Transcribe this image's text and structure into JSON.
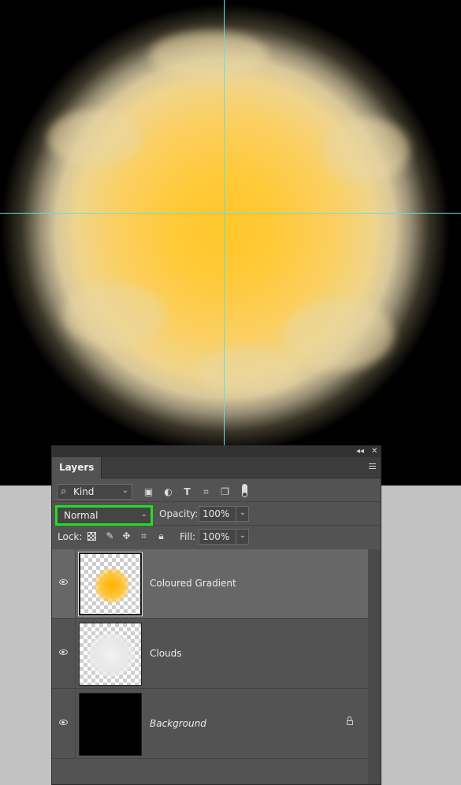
{
  "panel": {
    "collapse_label": "◂◂",
    "close_label": "✕",
    "tab_label": "Layers"
  },
  "filter": {
    "kind_label": "Kind",
    "icons": [
      "image-filter-icon",
      "adjustment-filter-icon",
      "type-filter-icon",
      "shape-filter-icon",
      "smart-object-filter-icon",
      "filter-toggle"
    ]
  },
  "blend": {
    "mode": "Normal",
    "opacity_label": "Opacity:",
    "opacity_value": "100%"
  },
  "lock": {
    "label": "Lock:",
    "fill_label": "Fill:",
    "fill_value": "100%",
    "icons": [
      "lock-transparent-icon",
      "lock-image-icon",
      "lock-position-icon",
      "lock-artboard-icon",
      "lock-all-icon"
    ]
  },
  "layers": [
    {
      "name": "Coloured Gradient",
      "selected": true,
      "visible": true
    },
    {
      "name": "Clouds",
      "selected": false,
      "visible": true
    },
    {
      "name": "Background",
      "selected": false,
      "visible": true,
      "locked": true
    }
  ],
  "colors": {
    "highlight": "#22dd22",
    "guide": "#5fe0e0",
    "panel_bg": "#535353"
  }
}
